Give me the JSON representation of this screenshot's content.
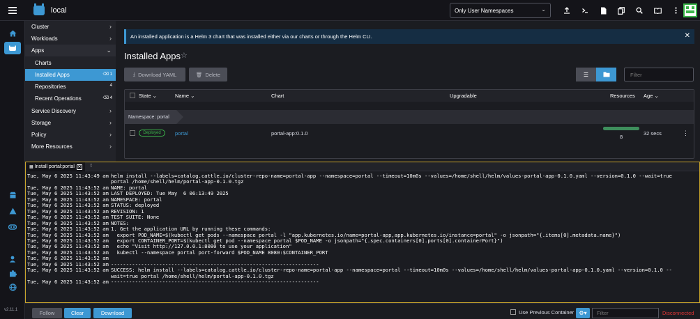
{
  "header": {
    "cluster_name": "local",
    "namespace_select": "Only User Namespaces",
    "icons": [
      "upload-icon",
      "terminal-icon",
      "file-icon",
      "copy-icon",
      "search-icon",
      "book-icon",
      "kebab-icon"
    ]
  },
  "rail": {
    "version": "v2.11.1",
    "icons": [
      "home-icon",
      "cluster-icon",
      "store-icon",
      "warning-icon",
      "network-icon",
      "user-icon",
      "extension-icon",
      "globe-icon"
    ]
  },
  "sidebar": {
    "items": [
      {
        "label": "Cluster"
      },
      {
        "label": "Workloads"
      },
      {
        "label": "Apps"
      },
      {
        "label": "Charts"
      },
      {
        "label": "Installed Apps",
        "count": "1"
      },
      {
        "label": "Repositories",
        "count": "4"
      },
      {
        "label": "Recent Operations",
        "count": "4"
      },
      {
        "label": "Service Discovery"
      },
      {
        "label": "Storage"
      },
      {
        "label": "Policy"
      },
      {
        "label": "More Resources"
      }
    ]
  },
  "main": {
    "banner": "An installed application is a Helm 3 chart that was installed either via our charts or through the Helm CLI.",
    "title": "Installed Apps",
    "download_yaml": "Download YAML",
    "delete": "Delete",
    "filter_placeholder": "Filter",
    "table": {
      "headers": {
        "state": "State",
        "name": "Name",
        "chart": "Chart",
        "upgradable": "Upgradable",
        "resources": "Resources",
        "age": "Age"
      },
      "namespace_label": "Namespace: portal",
      "row": {
        "state": "Deployed",
        "name": "portal",
        "chart": "portal-app:0.1.0",
        "resources": "8",
        "age": "32 secs",
        "resources_ready_fraction": 1.0
      }
    }
  },
  "terminal": {
    "tab_label": "Install portal:portal",
    "lines": [
      {
        "ts": "Tue, May 6 2025 11:43:49 am",
        "msg": "helm install --labels=catalog.cattle.io/cluster-repo-name=portal-app --namespace=portal --timeout=10m0s --values=/home/shell/helm/values-portal-app-0.1.0.yaml --version=0.1.0 --wait=true"
      },
      {
        "ts": "",
        "msg": "portal /home/shell/helm/portal-app-0.1.0.tgz"
      },
      {
        "ts": "Tue, May 6 2025 11:43:52 am",
        "msg": "NAME: portal"
      },
      {
        "ts": "Tue, May 6 2025 11:43:52 am",
        "msg": "LAST DEPLOYED: Tue May  6 06:13:49 2025"
      },
      {
        "ts": "Tue, May 6 2025 11:43:52 am",
        "msg": "NAMESPACE: portal"
      },
      {
        "ts": "Tue, May 6 2025 11:43:52 am",
        "msg": "STATUS: deployed"
      },
      {
        "ts": "Tue, May 6 2025 11:43:52 am",
        "msg": "REVISION: 1"
      },
      {
        "ts": "Tue, May 6 2025 11:43:52 am",
        "msg": "TEST SUITE: None"
      },
      {
        "ts": "Tue, May 6 2025 11:43:52 am",
        "msg": "NOTES:"
      },
      {
        "ts": "Tue, May 6 2025 11:43:52 am",
        "msg": "1. Get the application URL by running these commands:"
      },
      {
        "ts": "Tue, May 6 2025 11:43:52 am",
        "msg": "  export POD_NAME=$(kubectl get pods --namespace portal -l \"app.kubernetes.io/name=portal-app,app.kubernetes.io/instance=portal\" -o jsonpath=\"{.items[0].metadata.name}\")"
      },
      {
        "ts": "Tue, May 6 2025 11:43:52 am",
        "msg": "  export CONTAINER_PORT=$(kubectl get pod --namespace portal $POD_NAME -o jsonpath=\"{.spec.containers[0].ports[0].containerPort}\")"
      },
      {
        "ts": "Tue, May 6 2025 11:43:52 am",
        "msg": "  echo \"Visit http://127.0.0.1:8080 to use your application\""
      },
      {
        "ts": "Tue, May 6 2025 11:43:52 am",
        "msg": "  kubectl --namespace portal port-forward $POD_NAME 8080:$CONTAINER_PORT"
      },
      {
        "ts": "Tue, May 6 2025 11:43:52 am",
        "msg": ""
      },
      {
        "ts": "Tue, May 6 2025 11:43:52 am",
        "msg": "---------------------------------------------------------------------"
      },
      {
        "ts": "Tue, May 6 2025 11:43:52 am",
        "msg": "SUCCESS: helm install --labels=catalog.cattle.io/cluster-repo-name=portal-app --namespace=portal --timeout=10m0s --values=/home/shell/helm/values-portal-app-0.1.0.yaml --version=0.1.0 --"
      },
      {
        "ts": "",
        "msg": "wait=true portal /home/shell/helm/portal-app-0.1.0.tgz"
      },
      {
        "ts": "Tue, May 6 2025 11:43:52 am",
        "msg": "---------------------------------------------------------------------"
      }
    ]
  },
  "footer": {
    "follow": "Follow",
    "clear": "Clear",
    "download": "Download",
    "use_previous_container": "Use Previous Container",
    "filter_placeholder": "Filter",
    "status": "Disconnected"
  },
  "colors": {
    "accent": "#3d98d3",
    "success": "#3bb54a",
    "error": "#e23535",
    "terminal_border": "#c9a52c"
  }
}
